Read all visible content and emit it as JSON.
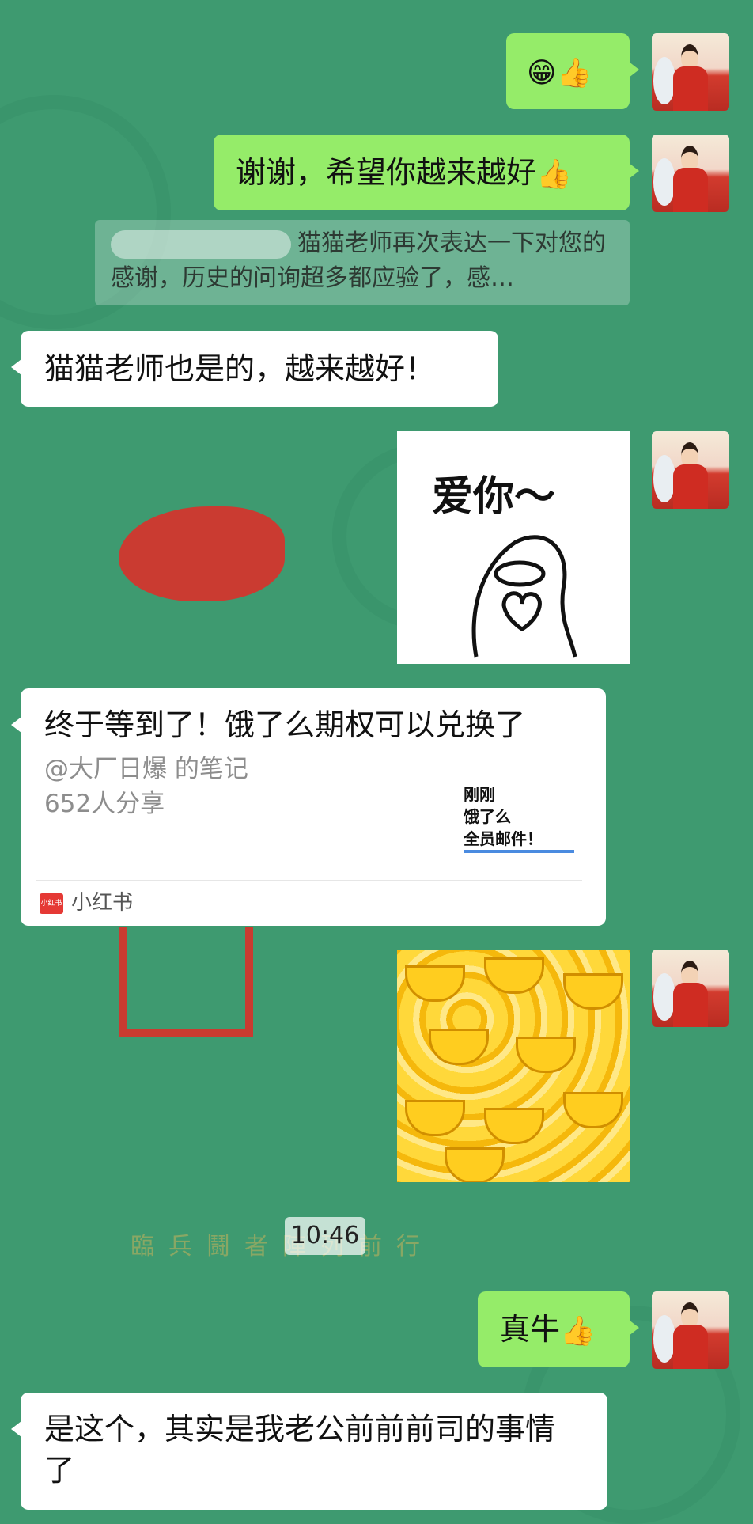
{
  "messages": {
    "m1_emoji": "😁👍",
    "m2_text": "谢谢，希望你越来越好",
    "m2_emoji": "👍",
    "quote_text": "猫猫老师再次表达一下对您的感谢，历史的问询超多都应验了，感…",
    "m3_text": "猫猫老师也是的，越来越好！",
    "sticker_love_text": "爱你～",
    "m6_text": "真牛",
    "m6_emoji": "👍",
    "m7_text": "是这个，其实是我老公前前前司的事情了"
  },
  "card": {
    "title": "终于等到了！饿了么期权可以兑换了",
    "author": "@大厂日爆 的笔记",
    "shares": "652人分享",
    "thumb_line1": "刚刚",
    "thumb_line2": "饿了么",
    "thumb_line3": "全员邮件！",
    "source_logo": "小红书",
    "source": "小红书"
  },
  "timestamp": "10:46",
  "background_text": "臨兵鬪者陣列前行",
  "colors": {
    "background": "#3e9a70",
    "my_bubble": "#95ec69",
    "other_bubble": "#ffffff"
  }
}
